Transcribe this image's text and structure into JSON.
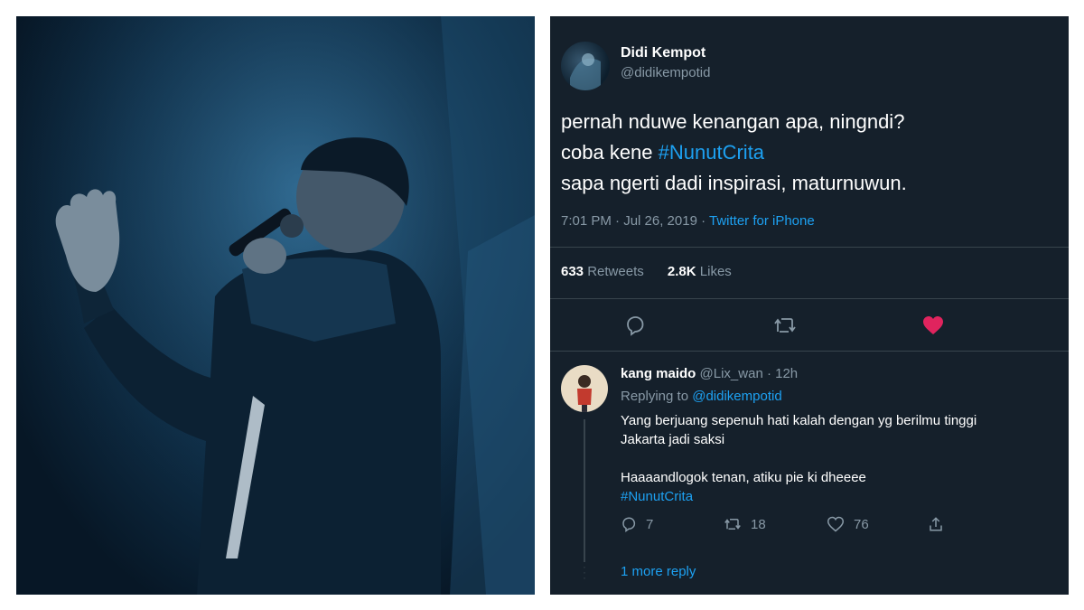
{
  "tweet": {
    "author_name": "Didi Kempot",
    "author_handle": "@didikempotid",
    "text_lines": [
      "pernah nduwe kenangan apa, ningndi?",
      "coba kene",
      "sapa ngerti dadi inspirasi, maturnuwun."
    ],
    "hashtag": "#NunutCrita",
    "time_date": "7:01 PM · Jul 26, 2019 · ",
    "source": "Twitter for iPhone",
    "retweets_count": "633",
    "retweets_label": "Retweets",
    "likes_count": "2.8K",
    "likes_label": "Likes",
    "like_color": "#e0245e"
  },
  "reply": {
    "name": "kang maido",
    "handle_time": "@Lix_wan · 12h",
    "replying_label": "Replying to",
    "replying_to": "@didikempotid",
    "body_lines": [
      "Yang berjuang sepenuh hati kalah dengan yg berilmu tinggi",
      "Jakarta jadi saksi",
      "",
      "Haaaandlogok tenan, atiku pie ki dheeee"
    ],
    "hashtag": "#NunutCrita",
    "reply_count": "7",
    "retweet_count": "18",
    "like_count": "76",
    "more_replies": "1 more reply"
  },
  "icons": [
    "reply-icon",
    "retweet-icon",
    "heart-icon",
    "share-icon"
  ]
}
